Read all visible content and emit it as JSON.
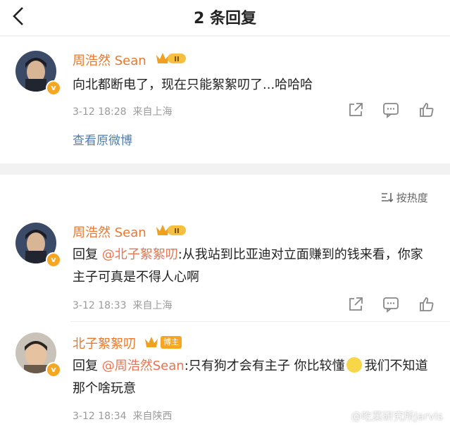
{
  "header": {
    "title": "2 条回复"
  },
  "original_comment": {
    "author": "周浩然 Sean",
    "rank_badge": "II",
    "content": "向北都断电了，现在只能絮絮叨了...哈哈哈",
    "time": "3-12 18:28",
    "location": "来自上海",
    "view_original": "查看原微博"
  },
  "sort": {
    "label": "按热度"
  },
  "replies": [
    {
      "author": "周浩然 Sean",
      "rank_badge": "II",
      "reply_prefix": "回复 ",
      "mention": "@北子絮絮叨",
      "content": ":从我站到比亚迪对立面赚到的钱来看，你家主子可真是不得人心啊",
      "time": "3-12 18:33",
      "location": "来自上海"
    },
    {
      "author": "北子絮絮叨",
      "bozhu_badge": "博主",
      "reply_prefix": "回复 ",
      "mention": "@周浩然Sean",
      "content": ":只有狗才会有主子 你比较懂",
      "content_after_emoji": "我们不知道那个啥玩意",
      "time": "3-12 18:34",
      "location": "来自陕西"
    }
  ],
  "watermark": "@吃菜研究所Jarvis",
  "icons": [
    "back-arrow-icon",
    "verified-v-icon",
    "crown-badge-icon",
    "share-icon",
    "comment-icon",
    "like-icon",
    "sort-icon",
    "emoji-icon"
  ],
  "colors": {
    "name": "#e8792e",
    "link": "#507daf",
    "mention": "#eb7350",
    "badge": "#f5a623"
  }
}
